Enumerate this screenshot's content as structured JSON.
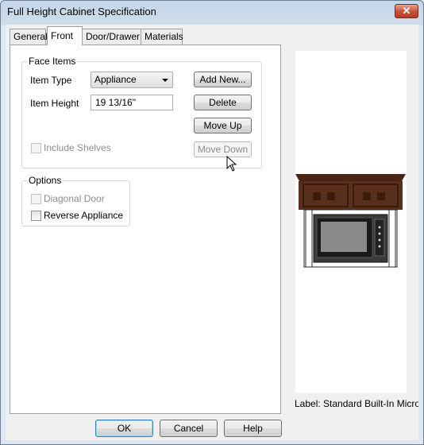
{
  "window": {
    "title": "Full Height Cabinet Specification",
    "close_glyph": "✕"
  },
  "tabs": [
    {
      "label": "General",
      "active": false
    },
    {
      "label": "Front",
      "active": true
    },
    {
      "label": "Door/Drawer",
      "active": false
    },
    {
      "label": "Materials",
      "active": false
    }
  ],
  "face_items": {
    "group_label": "Face Items",
    "item_type_label": "Item Type",
    "item_type_value": "Appliance",
    "item_height_label": "Item Height",
    "item_height_value": "19 13/16\"",
    "include_shelves_label": "Include Shelves",
    "include_shelves_checked": false,
    "buttons": {
      "add_new": "Add New...",
      "delete": "Delete",
      "move_up": "Move Up",
      "move_down": "Move Down"
    }
  },
  "options": {
    "group_label": "Options",
    "diagonal_door_label": "Diagonal Door",
    "diagonal_door_checked": false,
    "reverse_appliance_label": "Reverse Appliance",
    "reverse_appliance_checked": false
  },
  "preview": {
    "label": "Label:  Standard Built-In Microw",
    "cabinet_color": "#5a2e1c",
    "appliance_color": "#3a3a3a"
  },
  "footer": {
    "ok": "OK",
    "cancel": "Cancel",
    "help": "Help"
  }
}
